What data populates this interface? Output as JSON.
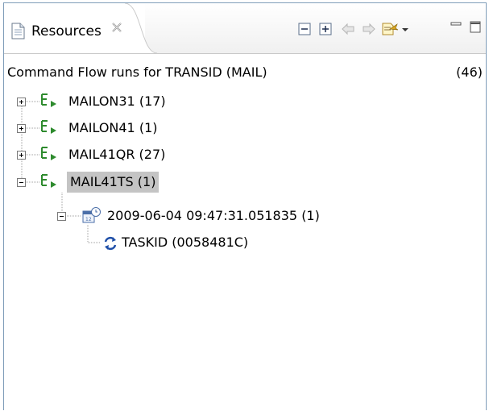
{
  "view": {
    "tab_label": "Resources",
    "tab_close_icon": "close-icon",
    "toolbar": [
      {
        "name": "collapse-all-icon"
      },
      {
        "name": "expand-all-icon"
      },
      {
        "name": "back-icon"
      },
      {
        "name": "forward-icon"
      },
      {
        "name": "filter-icon"
      },
      {
        "name": "view-menu-icon"
      },
      {
        "name": "minimize-icon"
      },
      {
        "name": "maximize-icon"
      }
    ]
  },
  "header": {
    "title": "Command Flow runs for TRANSID (MAIL)",
    "count": "(46)"
  },
  "tree": {
    "items": [
      {
        "label": "MAILON31",
        "count": "(17)",
        "expanded": false,
        "selected": false
      },
      {
        "label": "MAILON41",
        "count": "(1)",
        "expanded": false,
        "selected": false
      },
      {
        "label": "MAIL41QR",
        "count": "(27)",
        "expanded": false,
        "selected": false
      },
      {
        "label": "MAIL41TS",
        "count": "(1)",
        "expanded": true,
        "selected": true
      }
    ],
    "run": {
      "label": "2009-06-04 09:47:31.051835",
      "count": "(1)"
    },
    "task": {
      "label": "TASKID (0058481C)"
    }
  },
  "colors": {
    "flow_icon": "#2e8b2e",
    "selection": "#c4c4c4",
    "border": "#7f9db9",
    "task_icon": "#1f4fa8"
  }
}
